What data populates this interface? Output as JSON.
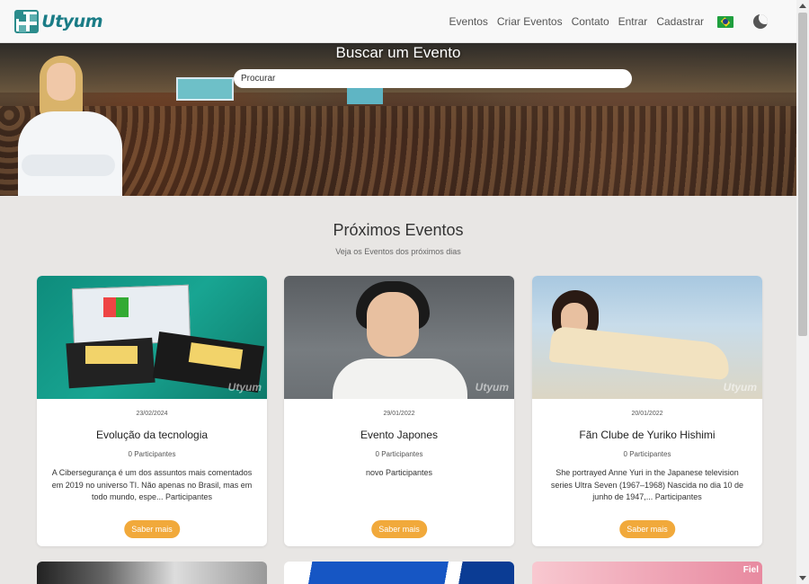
{
  "logo": {
    "text": "Utyum"
  },
  "nav": {
    "items": [
      "Eventos",
      "Criar Eventos",
      "Contato",
      "Entrar",
      "Cadastrar"
    ],
    "language_icon": "brazil-flag-icon",
    "theme_icon": "moon-icon"
  },
  "hero": {
    "title": "Buscar um Evento",
    "search_placeholder": "Procurar"
  },
  "section": {
    "title": "Próximos Eventos",
    "subtitle": "Veja os Eventos dos próximos dias"
  },
  "events": [
    {
      "date": "23/02/2024",
      "title": "Evolução da tecnologia",
      "participants": "0 Participantes",
      "description": "A Cibersegurança é um dos assuntos mais comentados em 2019 no universo TI. Não apenas no Brasil, mas em todo mundo, espe... Participantes",
      "button": "Saber mais",
      "watermark": "Utyum"
    },
    {
      "date": "29/01/2022",
      "title": "Evento Japones",
      "participants": "0 Participantes",
      "description": "novo Participantes",
      "button": "Saber mais",
      "watermark": "Utyum"
    },
    {
      "date": "20/01/2022",
      "title": "Fãn Clube de Yuriko Hishimi",
      "participants": "0 Participantes",
      "description": "She portrayed Anne Yuri in the Japanese television series Ultra Seven (1967–1968) Nascida no dia 10 de junho de 1947,... Participantes",
      "button": "Saber mais",
      "watermark": "Utyum"
    }
  ],
  "bottom_cards": {
    "third_label": "Fiel"
  },
  "colors": {
    "accent_button": "#f1a93b",
    "logo": "#1a7c86",
    "page_bg": "#e8e6e4"
  }
}
